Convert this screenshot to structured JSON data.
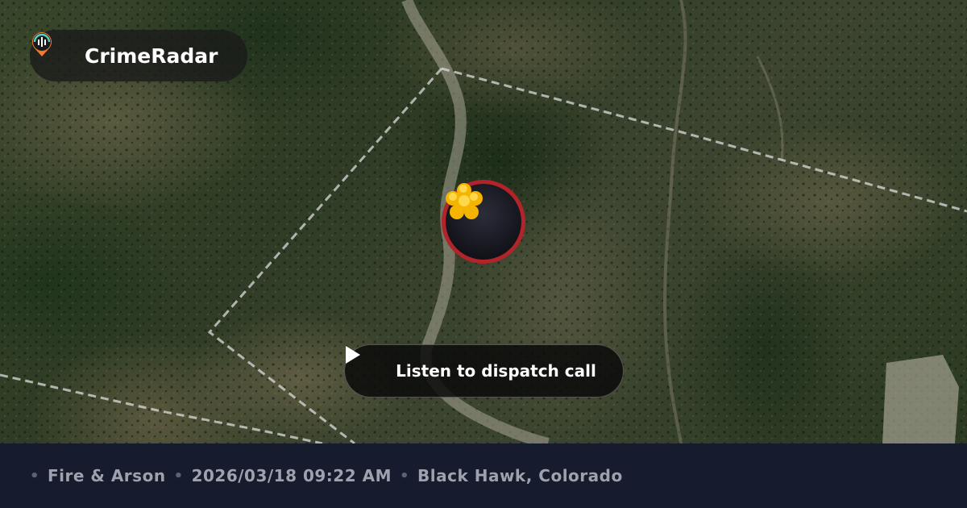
{
  "brand": {
    "name": "CrimeRadar",
    "logo_icon": "radar-pin-icon",
    "colors": {
      "teal": "#4fd1c5",
      "orange": "#f27a2f"
    }
  },
  "map": {
    "style": "satellite",
    "incident_icon": "fire-flower-icon",
    "marker_ring_color": "#b3242a"
  },
  "dispatch": {
    "label": "Listen to dispatch call",
    "icon": "play-icon"
  },
  "footer": {
    "category": "Fire & Arson",
    "datetime": "2026/03/18 09:22 AM",
    "location": "Black Hawk, Colorado",
    "separator": "•"
  }
}
